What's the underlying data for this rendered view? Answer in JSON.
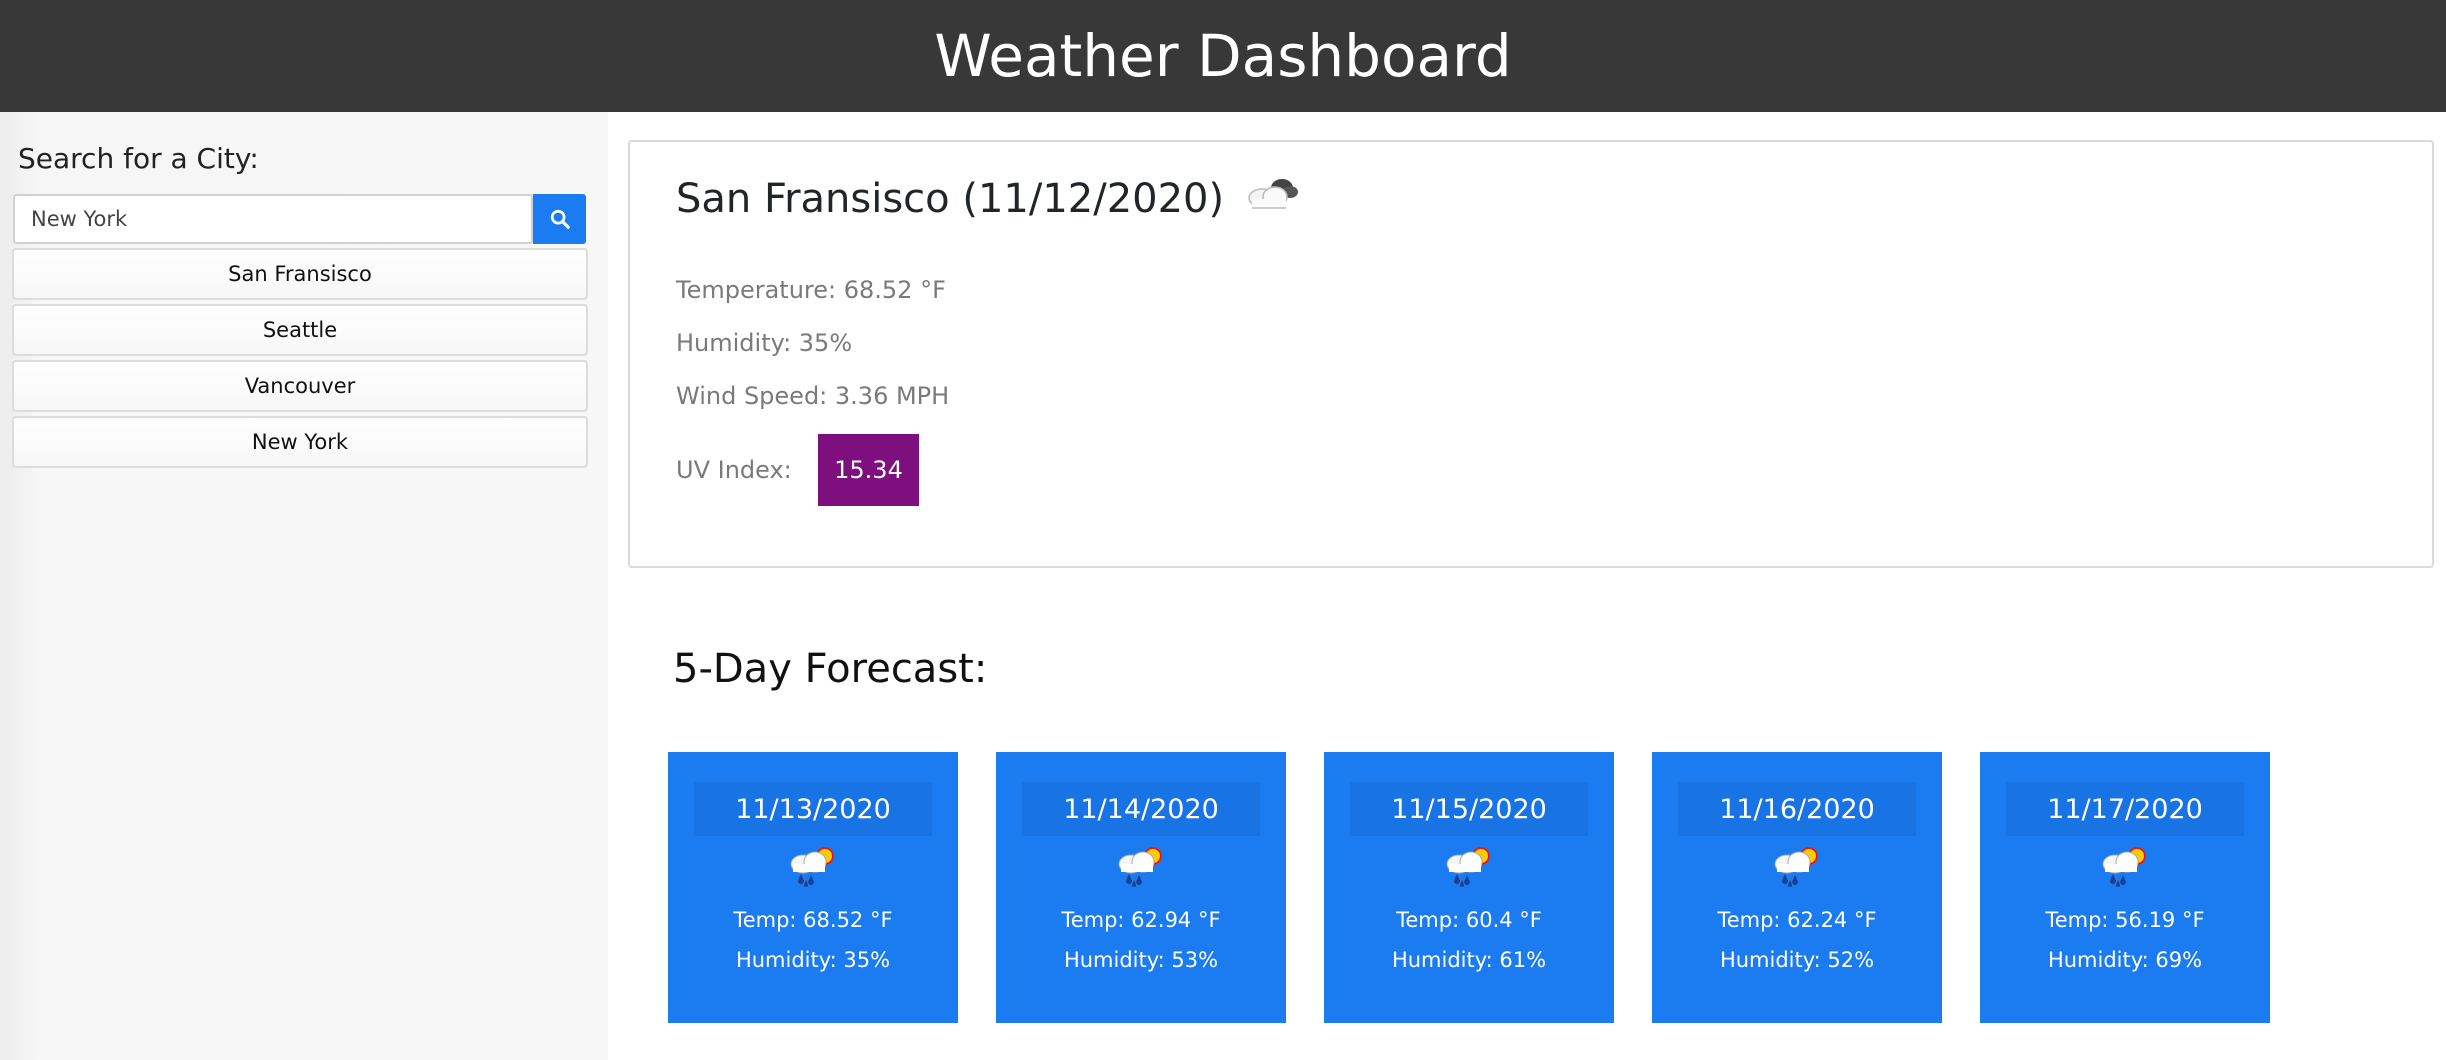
{
  "header": {
    "title": "Weather Dashboard"
  },
  "sidebar": {
    "search_label": "Search for a City:",
    "search_value": "New York",
    "search_icon": "search-icon",
    "cities": [
      "San Fransisco",
      "Seattle",
      "Vancouver",
      "New York"
    ]
  },
  "current": {
    "title": "San Fransisco (11/12/2020)",
    "icon": "partly-cloudy-icon",
    "temperature": "Temperature: 68.52 °F",
    "humidity": "Humidity: 35%",
    "wind": "Wind Speed: 3.36 MPH",
    "uv_label": "UV Index:",
    "uv_value": "15.34",
    "uv_color": "#7e0f7e"
  },
  "forecast": {
    "title": "5-Day Forecast:",
    "accent": "#1a7cf0",
    "days": [
      {
        "date": "11/13/2020",
        "icon": "rain-sun-icon",
        "temp": "Temp: 68.52 °F",
        "humidity": "Humidity: 35%"
      },
      {
        "date": "11/14/2020",
        "icon": "rain-sun-icon",
        "temp": "Temp: 62.94 °F",
        "humidity": "Humidity: 53%"
      },
      {
        "date": "11/15/2020",
        "icon": "rain-sun-icon",
        "temp": "Temp: 60.4 °F",
        "humidity": "Humidity: 61%"
      },
      {
        "date": "11/16/2020",
        "icon": "rain-sun-icon",
        "temp": "Temp: 62.24 °F",
        "humidity": "Humidity: 52%"
      },
      {
        "date": "11/17/2020",
        "icon": "rain-sun-icon",
        "temp": "Temp: 56.19 °F",
        "humidity": "Humidity: 69%"
      }
    ]
  }
}
